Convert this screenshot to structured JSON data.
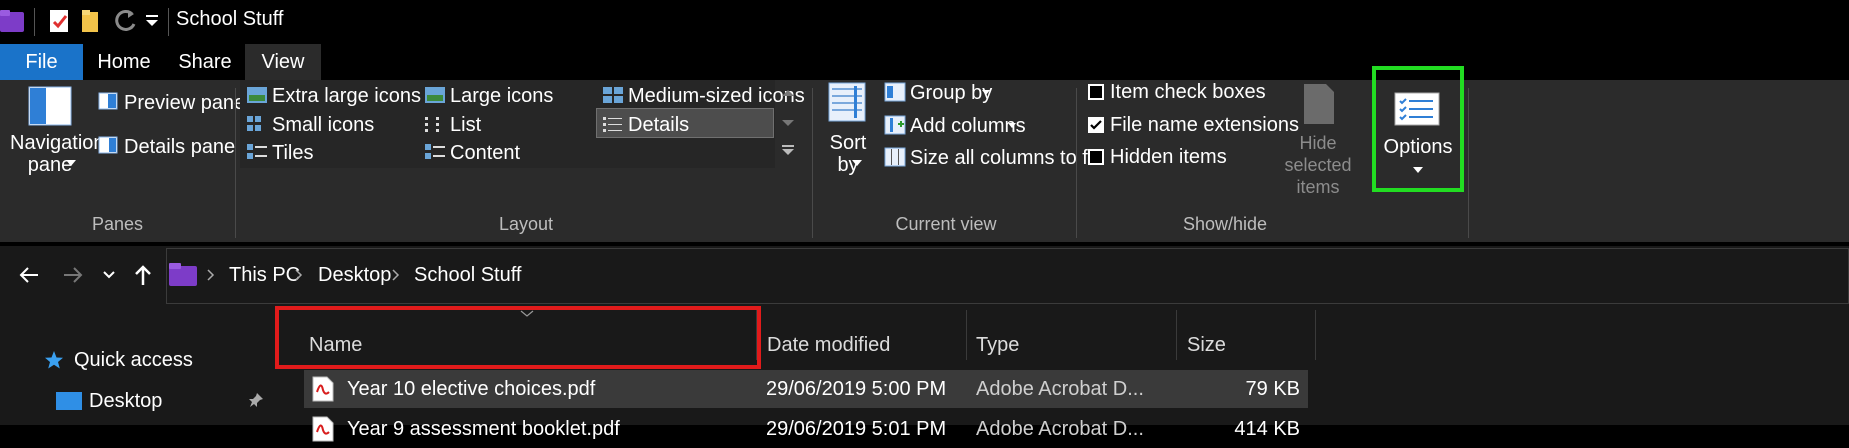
{
  "titlebar": {
    "title": "School Stuff",
    "folder_color": "#7d3cc8",
    "qat_icons": [
      "folder-icon",
      "properties-icon",
      "new-folder-icon",
      "redo-icon",
      "customize-chevron-icon"
    ]
  },
  "tabs": [
    {
      "label": "File",
      "active_color": "#1a73c9"
    },
    {
      "label": "Home"
    },
    {
      "label": "Share"
    },
    {
      "label": "View"
    }
  ],
  "ribbon": {
    "panes": {
      "navigation_pane": "Navigation\npane",
      "preview_pane": "Preview pane",
      "details_pane": "Details pane",
      "label": "Panes"
    },
    "layout": {
      "items": [
        "Extra large icons",
        "Large icons",
        "Medium-sized icons",
        "Small icons",
        "List",
        "Details",
        "Tiles",
        "Content"
      ],
      "selected": "Details",
      "label": "Layout"
    },
    "current_view": {
      "sort_by": "Sort\nby",
      "group_by": "Group by",
      "add_columns": "Add columns",
      "size_all_columns": "Size all columns to fit",
      "label": "Current view"
    },
    "show_hide": {
      "item_check_boxes": "Item check boxes",
      "file_name_extensions": "File name extensions",
      "hidden_items": "Hidden items",
      "hide_selected_items": "Hide selected\nitems",
      "label": "Show/hide",
      "item_check_boxes_checked": false,
      "file_name_extensions_checked": true,
      "hidden_items_checked": false
    },
    "options": {
      "label": "Options",
      "highlight_color": "#22dd22"
    }
  },
  "address": {
    "crumbs": [
      "This PC",
      "Desktop",
      "School Stuff"
    ]
  },
  "nav": {
    "quick_access": "Quick access",
    "desktop": "Desktop"
  },
  "columns": {
    "name": "Name",
    "date_modified": "Date modified",
    "type": "Type",
    "size": "Size",
    "name_highlight_color": "#e11b1b"
  },
  "files": [
    {
      "name": "Year 10 elective choices.pdf",
      "date": "29/06/2019 5:00 PM",
      "type": "Adobe Acrobat D...",
      "size": "79 KB"
    },
    {
      "name": "Year 9 assessment booklet.pdf",
      "date": "29/06/2019 5:01 PM",
      "type": "Adobe Acrobat D...",
      "size": "414 KB"
    }
  ]
}
